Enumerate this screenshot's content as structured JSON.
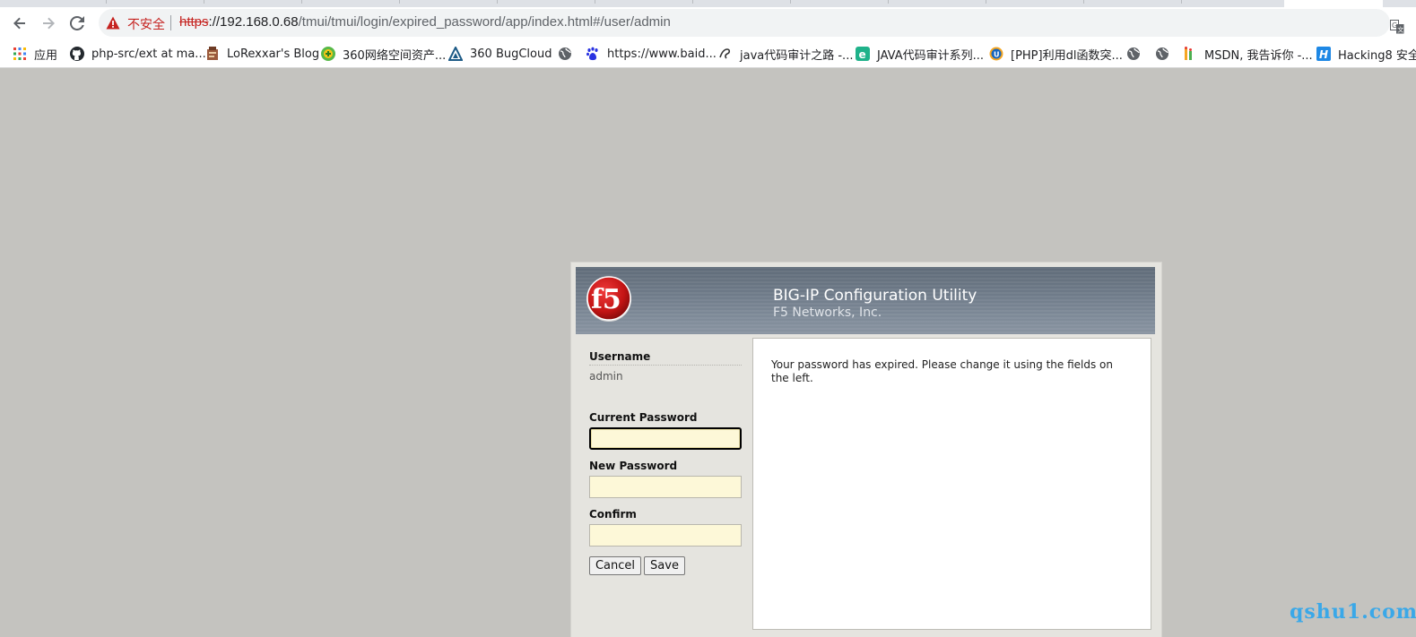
{
  "browser": {
    "security_label": "不安全",
    "url_scheme": "https",
    "url_host": "://192.168.0.68",
    "url_path": "/tmui/tmui/login/expired_password/app/index.html#/user/admin",
    "nav_icons": [
      "back-arrow-icon",
      "forward-arrow-icon",
      "reload-icon"
    ]
  },
  "bookmarks": [
    {
      "label": "应用",
      "icon": "apps-grid-icon"
    },
    {
      "label": "php-src/ext at ma...",
      "icon": "github-icon"
    },
    {
      "label": "LoRexxar's Blog",
      "icon": "blog-icon"
    },
    {
      "label": "360网络空间资产...",
      "icon": "360-icon"
    },
    {
      "label": "360 BugCloud",
      "icon": "bugcloud-icon"
    },
    {
      "label": "",
      "icon": "globe-icon"
    },
    {
      "label": "https://www.baid...",
      "icon": "baidu-icon"
    },
    {
      "label": "java代码审计之路 -...",
      "icon": "swirl-icon"
    },
    {
      "label": "JAVA代码审计系列...",
      "icon": "e-icon"
    },
    {
      "label": "[PHP]利用dl函数突...",
      "icon": "u-badge-icon"
    },
    {
      "label": "",
      "icon": "globe-icon"
    },
    {
      "label": "",
      "icon": "globe-icon"
    },
    {
      "label": "MSDN, 我告诉你 -...",
      "icon": "msdn-icon"
    },
    {
      "label": "Hacking8 安全",
      "icon": "h-icon"
    }
  ],
  "app": {
    "title": "BIG-IP Configuration Utility",
    "subtitle": "F5 Networks, Inc.",
    "logo_text": "f5",
    "username_label": "Username",
    "username_value": "admin",
    "current_password_label": "Current Password",
    "new_password_label": "New Password",
    "confirm_label": "Confirm",
    "cancel_label": "Cancel",
    "save_label": "Save",
    "message": "Your password has expired. Please change it using the fields on the left."
  },
  "watermark": "qshu1.com",
  "colors": {
    "page_bg": "#c4c3bf",
    "banner": "#6c7886",
    "input_bg": "#fdf8d8",
    "insecure_red": "#c5221f",
    "watermark": "#3aa8e8"
  }
}
